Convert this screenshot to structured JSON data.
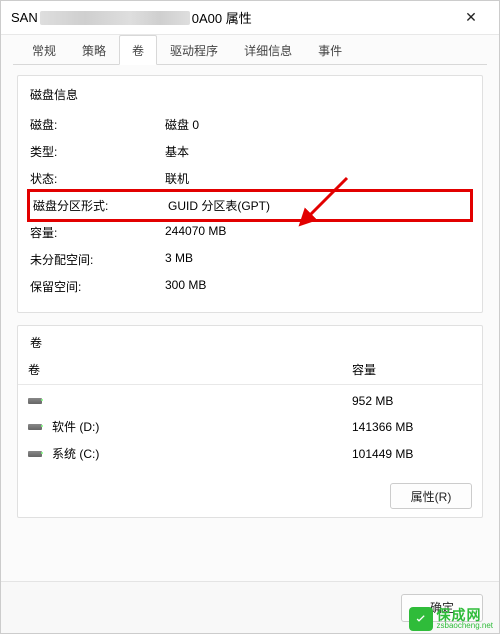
{
  "window": {
    "title_prefix": "SAN",
    "title_suffix": "0A00 属性",
    "close_glyph": "✕"
  },
  "tabs": [
    {
      "id": "general",
      "label": "常规",
      "active": false
    },
    {
      "id": "policy",
      "label": "策略",
      "active": false
    },
    {
      "id": "volumes",
      "label": "卷",
      "active": true
    },
    {
      "id": "driver",
      "label": "驱动程序",
      "active": false
    },
    {
      "id": "details",
      "label": "详细信息",
      "active": false
    },
    {
      "id": "events",
      "label": "事件",
      "active": false
    }
  ],
  "disk_info": {
    "group_title": "磁盘信息",
    "rows": {
      "disk": {
        "label": "磁盘:",
        "value": "磁盘 0"
      },
      "type": {
        "label": "类型:",
        "value": "基本"
      },
      "status": {
        "label": "状态:",
        "value": "联机"
      },
      "partition": {
        "label": "磁盘分区形式:",
        "value": "GUID 分区表(GPT)"
      },
      "capacity": {
        "label": "容量:",
        "value": "244070 MB"
      },
      "unallocated": {
        "label": "未分配空间:",
        "value": "3 MB"
      },
      "reserved": {
        "label": "保留空间:",
        "value": "300 MB"
      }
    }
  },
  "volumes": {
    "group_title": "卷",
    "header": {
      "name": "卷",
      "capacity": "容量"
    },
    "items": [
      {
        "name": "",
        "capacity": "952 MB"
      },
      {
        "name": "软件 (D:)",
        "capacity": "141366 MB"
      },
      {
        "name": "系统 (C:)",
        "capacity": "101449 MB"
      }
    ],
    "properties_button": "属性(R)"
  },
  "footer": {
    "ok": "确定"
  },
  "watermark": {
    "cn": "保成网",
    "url": "zsbaocheng.net"
  },
  "annotation": {
    "arrow_color": "#e20000"
  }
}
